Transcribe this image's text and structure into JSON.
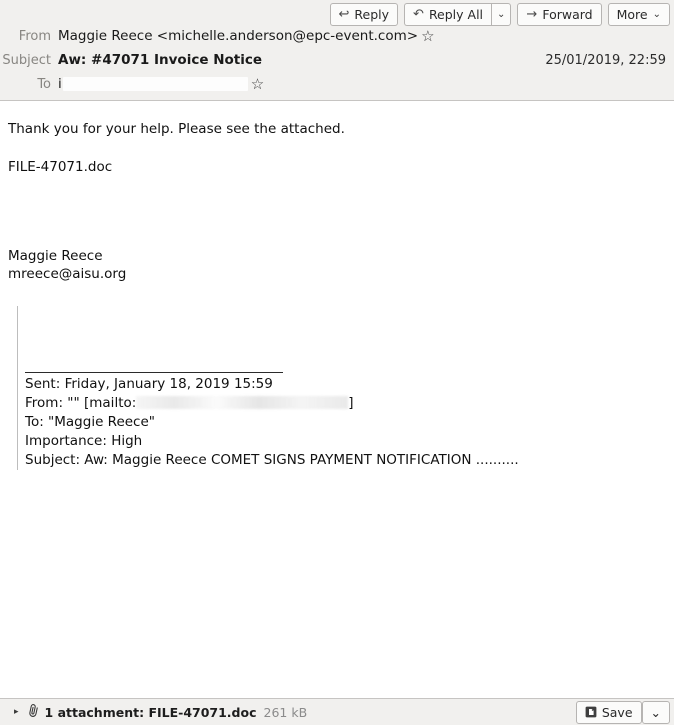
{
  "toolbar": {
    "reply": {
      "label": "Reply",
      "icon": "reply-arrow-icon"
    },
    "reply_all": {
      "label": "Reply All",
      "icon": "reply-all-arrow-icon",
      "dropdown": "⌄"
    },
    "forward": {
      "label": "Forward",
      "icon": "forward-arrow-icon"
    },
    "more": {
      "label": "More",
      "dropdown": "⌄"
    }
  },
  "header": {
    "from_label": "From",
    "from_value": "Maggie Reece <michelle.anderson@epc-event.com>",
    "subject_label": "Subject",
    "subject_value": "Aw: #47071 Invoice Notice",
    "date": "25/01/2019, 22:59",
    "to_label": "To",
    "to_value": "i",
    "star": "☆"
  },
  "body": {
    "greeting": "Thank you for your help. Please see the attached.",
    "file_line": "FILE-47071.doc",
    "signature_name": "Maggie Reece",
    "signature_email": "mreece@aisu.org",
    "quote": {
      "sent": "Sent: Friday, January 18, 2019 15:59",
      "from_prefix": "From: \"\" [mailto:",
      "from_suffix": "]",
      "to": "To: \"Maggie Reece\"",
      "importance": "Importance: High",
      "subject": "Subject: Aw: Maggie Reece COMET SIGNS PAYMENT NOTIFICATION .........."
    }
  },
  "attachment": {
    "twisty": "▸",
    "clip": "📎",
    "text": "1 attachment: FILE-47071.doc",
    "size": "261 kB",
    "save_label": "Save",
    "save_dropdown": "⌄"
  },
  "colors": {
    "header_bg": "#f1f0ee",
    "border": "#c6c4c2",
    "body_bg": "#ffffff",
    "label_gray": "#888682",
    "quote_bar": "#bdbdbd"
  }
}
